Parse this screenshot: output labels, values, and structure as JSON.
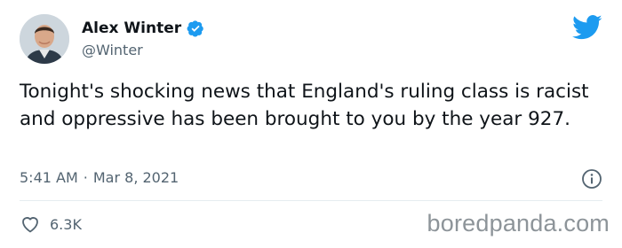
{
  "author": {
    "display_name": "Alex Winter",
    "handle": "@Winter",
    "verified": true,
    "verified_icon": "verified-badge-icon",
    "avatar": "profile-photo"
  },
  "tweet": {
    "text": "Tonight's shocking news that England's ruling class is racist and oppressive has been brought to you by the year 927.",
    "time": "5:41 AM",
    "separator": "·",
    "date": "Mar 8, 2021"
  },
  "engagement": {
    "likes": "6.3K",
    "like_icon": "heart-icon"
  },
  "icons": {
    "brand": "twitter-bird-icon",
    "info": "info-icon"
  },
  "watermark": "boredpanda.com",
  "colors": {
    "brand_blue": "#1d9bf0",
    "text_primary": "#0f1419",
    "text_secondary": "#536471",
    "divider": "#e6ecf0",
    "watermark": "#8d9499"
  }
}
